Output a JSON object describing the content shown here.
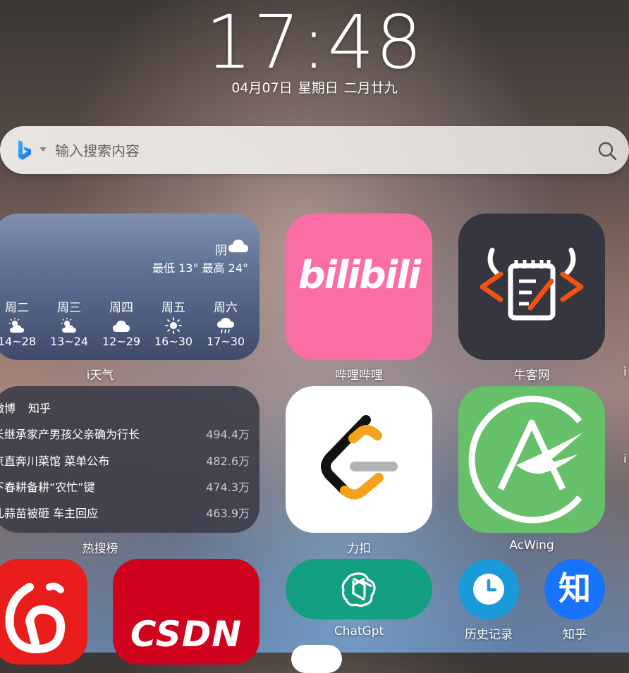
{
  "clock": {
    "time": "17:48",
    "date": "04月07日",
    "weekday": "星期日",
    "lunar": "二月廿九"
  },
  "search": {
    "placeholder": "输入搜索内容",
    "engine_icon": "bing-icon",
    "submit_icon": "search-icon"
  },
  "weather_widget": {
    "label": "i天气",
    "condition": "阴",
    "range": "最低 13° 最高 24°",
    "forecast": [
      {
        "day": "周二",
        "icon": "sun-cloud-icon",
        "temp": "14~28"
      },
      {
        "day": "周三",
        "icon": "sun-cloud-icon",
        "temp": "13~24"
      },
      {
        "day": "周四",
        "icon": "cloud-icon",
        "temp": "12~29"
      },
      {
        "day": "周五",
        "icon": "sun-icon",
        "temp": "16~30"
      },
      {
        "day": "周六",
        "icon": "rain-icon",
        "temp": "17~30"
      }
    ]
  },
  "hot_widget": {
    "label": "热搜榜",
    "tabs": [
      "微博",
      "知乎"
    ],
    "items": [
      {
        "title": "长继承家产男孩父亲确为行长",
        "value": "494.4万"
      },
      {
        "title": "京直奔川菜馆 菜单公布",
        "value": "482.6万"
      },
      {
        "title": "下春耕备耕“农忙”键",
        "value": "474.3万"
      },
      {
        "title": "轧蒜苗被砸 车主回应",
        "value": "463.9万"
      }
    ]
  },
  "apps": {
    "bilibili": {
      "label": "哔哩哔哩",
      "logo_text": "bilibili"
    },
    "nowcoder": {
      "label": "牛客网"
    },
    "leetcode": {
      "label": "力扣"
    },
    "acwing": {
      "label": "AcWing"
    },
    "chatgpt": {
      "label": "ChatGpt"
    },
    "history": {
      "label": "历史记录"
    },
    "zhihu": {
      "label": "知乎",
      "logo_text": "知"
    },
    "csdn": {
      "logo_text": "CSDN"
    },
    "right_edge_partial": "i"
  },
  "colors": {
    "bilibili": "#fb6ea5",
    "nowcoder": "#353640",
    "acwing": "#66c06a",
    "chatgpt": "#12a080",
    "history": "#1a9ad8",
    "zhihu": "#1773f7",
    "netease": "#ea1d1d",
    "csdn": "#d0031e",
    "nowcoder_accent": "#f0520f"
  }
}
